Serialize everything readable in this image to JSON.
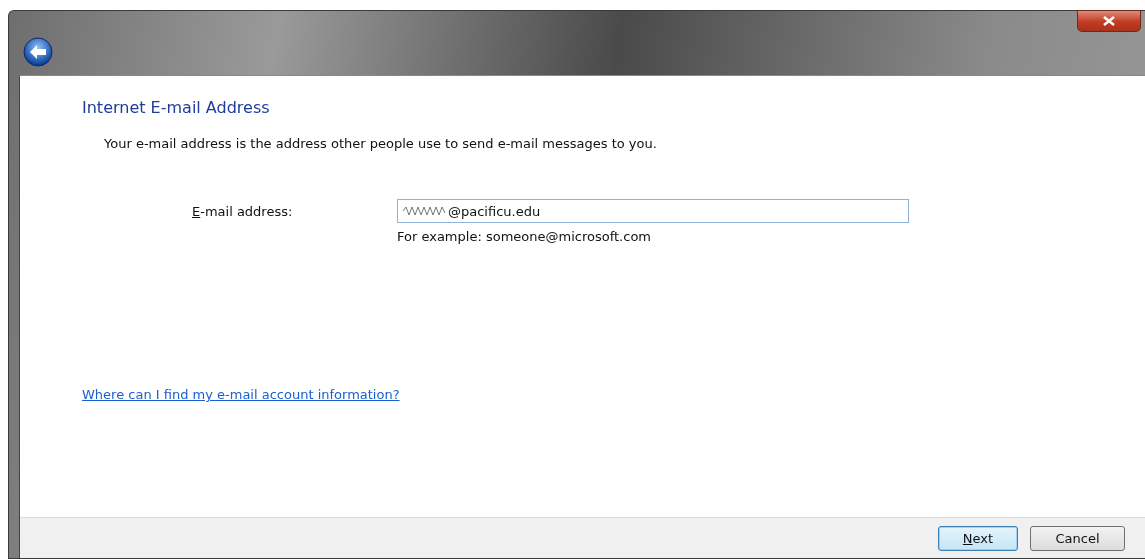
{
  "heading": "Internet E-mail Address",
  "description": "Your e-mail address is the address other people use to send e-mail messages to you.",
  "email_field": {
    "label": {
      "accel": "E",
      "rest": "-mail address:"
    },
    "value": "@pacificu.edu",
    "hint": "For example: someone@microsoft.com"
  },
  "help_link": "Where can I find my e-mail account information?",
  "buttons": [
    {
      "accel": "N",
      "rest": "ext",
      "kind": "default"
    },
    {
      "rest": "Cancel",
      "kind": "normal"
    }
  ]
}
